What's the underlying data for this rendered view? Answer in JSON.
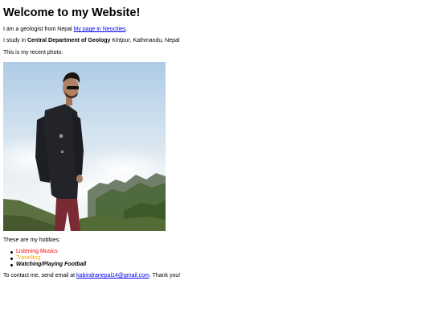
{
  "heading": "Welcome to my Website!",
  "intro": {
    "prefix": "I am a geologist from Nepal ",
    "link_text": "My page in Neocities",
    "suffix": "."
  },
  "study": {
    "prefix": "I study in ",
    "department": "Central Department of Geology",
    "campus": "Kirtipur",
    "suffix": ", Kathmandu, Nepal"
  },
  "photo_caption": "This is my recent photo:",
  "hobbies_intro": "These are my hobbies:",
  "hobbies": [
    {
      "label": "Listening Musics",
      "color": "#ff0000"
    },
    {
      "label": "Travelling",
      "color": "#ffa500"
    },
    {
      "label": "Watching/Playing Football",
      "color": "#000000"
    }
  ],
  "contact": {
    "prefix": "To contact me, send email at ",
    "email": "kabindranepal14@gmail.com",
    "suffix": ". Thank you!"
  }
}
